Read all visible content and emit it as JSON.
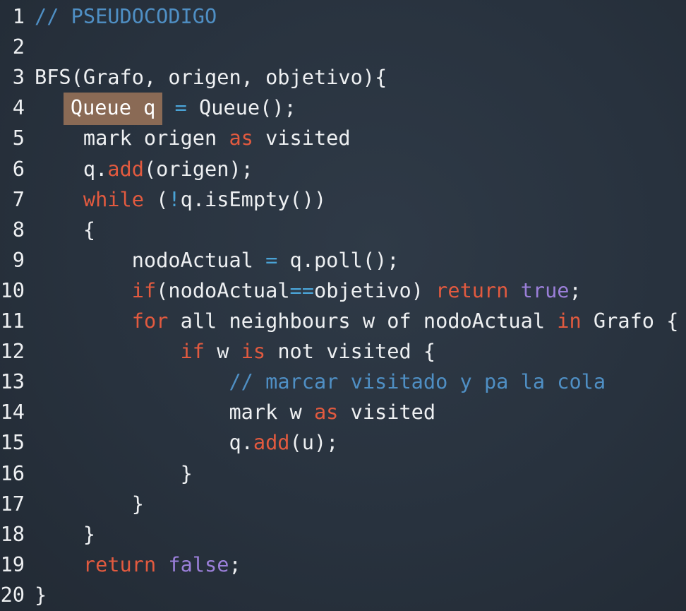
{
  "editor": {
    "theme_colors": {
      "background": "#28323e",
      "text": "#eef0f2",
      "keyword": "#e25a3f",
      "operator": "#4aa3d6",
      "literal": "#9b7fd9",
      "comment": "#4f8fc4",
      "highlight": "#8a6a55"
    },
    "highlighted_line": 4,
    "lines": [
      {
        "number": "1",
        "tokens": [
          {
            "t": "// PSEUDOCODIGO",
            "k": "comment"
          }
        ]
      },
      {
        "number": "2",
        "tokens": []
      },
      {
        "number": "3",
        "tokens": [
          {
            "t": "BFS(Grafo, origen, objetivo){",
            "k": "plain"
          }
        ]
      },
      {
        "number": "4",
        "tokens": [
          {
            "t": "    ",
            "k": "plain"
          },
          {
            "t": "Queue q",
            "k": "hl"
          },
          {
            "t": " ",
            "k": "plain"
          },
          {
            "t": "=",
            "k": "operator"
          },
          {
            "t": " Queue();",
            "k": "plain"
          }
        ]
      },
      {
        "number": "5",
        "tokens": [
          {
            "t": "    mark origen ",
            "k": "plain"
          },
          {
            "t": "as",
            "k": "keyword"
          },
          {
            "t": " visited",
            "k": "plain"
          }
        ]
      },
      {
        "number": "6",
        "tokens": [
          {
            "t": "    q.",
            "k": "plain"
          },
          {
            "t": "add",
            "k": "keyword"
          },
          {
            "t": "(origen);",
            "k": "plain"
          }
        ]
      },
      {
        "number": "7",
        "tokens": [
          {
            "t": "    ",
            "k": "plain"
          },
          {
            "t": "while",
            "k": "keyword"
          },
          {
            "t": " (",
            "k": "plain"
          },
          {
            "t": "!",
            "k": "operator"
          },
          {
            "t": "q.isEmpty())",
            "k": "plain"
          }
        ]
      },
      {
        "number": "8",
        "tokens": [
          {
            "t": "    {",
            "k": "plain"
          }
        ]
      },
      {
        "number": "9",
        "tokens": [
          {
            "t": "        nodoActual ",
            "k": "plain"
          },
          {
            "t": "=",
            "k": "operator"
          },
          {
            "t": " q.poll();",
            "k": "plain"
          }
        ]
      },
      {
        "number": "10",
        "tokens": [
          {
            "t": "        ",
            "k": "plain"
          },
          {
            "t": "if",
            "k": "keyword"
          },
          {
            "t": "(nodoActual",
            "k": "plain"
          },
          {
            "t": "==",
            "k": "operator"
          },
          {
            "t": "objetivo) ",
            "k": "plain"
          },
          {
            "t": "return",
            "k": "keyword"
          },
          {
            "t": " ",
            "k": "plain"
          },
          {
            "t": "true",
            "k": "literal"
          },
          {
            "t": ";",
            "k": "plain"
          }
        ]
      },
      {
        "number": "11",
        "tokens": [
          {
            "t": "        ",
            "k": "plain"
          },
          {
            "t": "for",
            "k": "keyword"
          },
          {
            "t": " all neighbours w of nodoActual ",
            "k": "plain"
          },
          {
            "t": "in",
            "k": "keyword"
          },
          {
            "t": " Grafo {",
            "k": "plain"
          }
        ]
      },
      {
        "number": "12",
        "tokens": [
          {
            "t": "            ",
            "k": "plain"
          },
          {
            "t": "if",
            "k": "keyword"
          },
          {
            "t": " w ",
            "k": "plain"
          },
          {
            "t": "is",
            "k": "keyword"
          },
          {
            "t": " not visited {",
            "k": "plain"
          }
        ]
      },
      {
        "number": "13",
        "tokens": [
          {
            "t": "                ",
            "k": "plain"
          },
          {
            "t": "// marcar visitado y pa la cola",
            "k": "comment"
          }
        ]
      },
      {
        "number": "14",
        "tokens": [
          {
            "t": "                mark w ",
            "k": "plain"
          },
          {
            "t": "as",
            "k": "keyword"
          },
          {
            "t": " visited",
            "k": "plain"
          }
        ]
      },
      {
        "number": "15",
        "tokens": [
          {
            "t": "                q.",
            "k": "plain"
          },
          {
            "t": "add",
            "k": "keyword"
          },
          {
            "t": "(u);",
            "k": "plain"
          }
        ]
      },
      {
        "number": "16",
        "tokens": [
          {
            "t": "            }",
            "k": "plain"
          }
        ]
      },
      {
        "number": "17",
        "tokens": [
          {
            "t": "        }",
            "k": "plain"
          }
        ]
      },
      {
        "number": "18",
        "tokens": [
          {
            "t": "    }",
            "k": "plain"
          }
        ]
      },
      {
        "number": "19",
        "tokens": [
          {
            "t": "    ",
            "k": "plain"
          },
          {
            "t": "return",
            "k": "keyword"
          },
          {
            "t": " ",
            "k": "plain"
          },
          {
            "t": "false",
            "k": "literal"
          },
          {
            "t": ";",
            "k": "plain"
          }
        ]
      },
      {
        "number": "20",
        "tokens": [
          {
            "t": "}",
            "k": "plain"
          }
        ]
      }
    ]
  }
}
